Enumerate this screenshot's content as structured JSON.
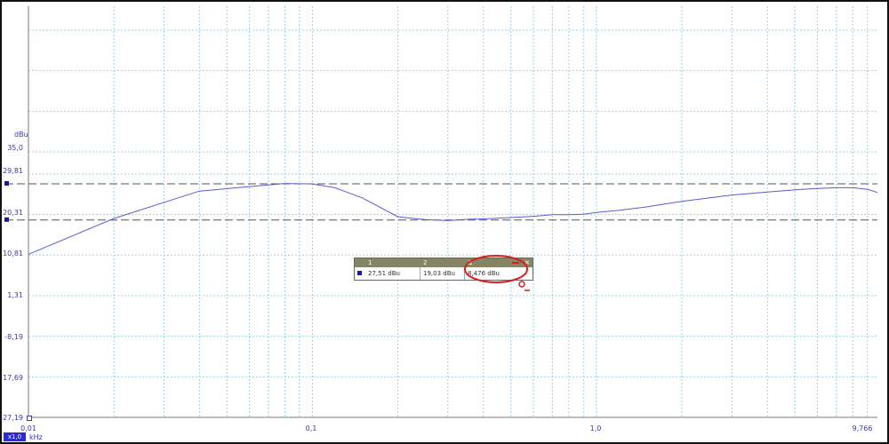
{
  "chart_data": {
    "type": "line",
    "x_scale": "log",
    "y_unit": "dBu",
    "x_unit": "kHz",
    "xlim": [
      0.01,
      9.766
    ],
    "ylim": [
      -27.19,
      35.0
    ],
    "y_ticks": [
      "35,0",
      "29,81",
      "20,31",
      "10,81",
      "1,31",
      "-8,19",
      "-17,69",
      "-27,19"
    ],
    "y_tick_values": [
      35.0,
      29.81,
      20.31,
      10.81,
      1.31,
      -8.19,
      -17.69,
      -27.19
    ],
    "x_ticks": [
      "0,01",
      "0,1",
      "1,0",
      "9,766"
    ],
    "x_tick_values": [
      0.01,
      0.1,
      1.0,
      9.766
    ],
    "cursor_levels": [
      27.51,
      19.03
    ],
    "grid": true,
    "line_color": "#5a5ad8",
    "grid_color": "#9bd0e6",
    "series": [
      {
        "x": [
          0.01,
          0.02,
          0.04,
          0.08,
          0.1,
          0.12,
          0.15,
          0.2,
          0.25,
          0.3,
          0.35,
          0.4,
          0.5,
          0.6,
          0.7,
          0.8,
          0.9,
          1.0,
          1.2,
          1.5,
          2.0,
          3.0,
          4.0,
          5.0,
          6.0,
          7.0,
          8.0,
          9.0,
          9.766
        ],
        "y": [
          11.0,
          19.4,
          25.8,
          27.6,
          27.5,
          26.6,
          24.2,
          19.8,
          19.1,
          18.9,
          19.2,
          19.3,
          19.6,
          19.9,
          20.3,
          20.3,
          20.4,
          20.8,
          21.3,
          22.1,
          23.4,
          24.9,
          25.6,
          26.1,
          26.4,
          26.6,
          26.6,
          26.2,
          25.5
        ]
      }
    ]
  },
  "readout": {
    "headers": [
      "1",
      "2",
      "Δ"
    ],
    "values": [
      "27,51 dBu",
      "19,03 dBu",
      "8,476 dBu"
    ],
    "close_label": "×"
  },
  "labels": {
    "y_unit": "dBu",
    "x_unit": "kHz",
    "zoom": "x1,0"
  }
}
